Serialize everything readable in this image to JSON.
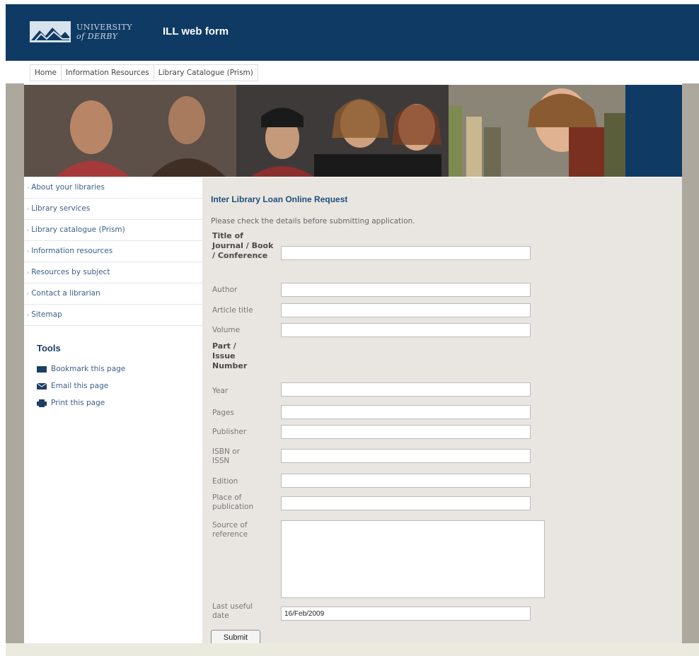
{
  "header": {
    "logo_line1": "UNIVERSITY",
    "logo_line2": "of DERBY",
    "app_title": "ILL web form"
  },
  "topnav": [
    "Home",
    "Information Resources",
    "Library Catalogue (Prism)"
  ],
  "sidebar": {
    "items": [
      "About your libraries",
      "Library services",
      "Library catalogue (Prism)",
      "Information resources",
      "Resources by subject",
      "Contact a librarian",
      "Sitemap"
    ],
    "tools_title": "Tools",
    "tools": [
      {
        "label": "Bookmark this page",
        "icon": "bookmark-icon"
      },
      {
        "label": "Email this page",
        "icon": "email-icon"
      },
      {
        "label": "Print this page",
        "icon": "print-icon"
      }
    ]
  },
  "form": {
    "title": "Inter Library Loan Online Request",
    "intro": "Please check the details before submitting application.",
    "fields": {
      "title_label": "Title of Journal / Book / Conference",
      "title_value": "",
      "author_label": "Author",
      "article_label": "Article title",
      "volume_label": "Volume",
      "part_label": "Part / Issue Number",
      "year_label": "Year",
      "pages_label": "Pages",
      "publisher_label": "Publisher",
      "isbn_label": "ISBN or ISSN",
      "edition_label": "Edition",
      "place_label": "Place of publication",
      "source_label": "Source of reference",
      "lastdate_label": "Last useful date",
      "lastdate_value": "16/Feb/2009"
    },
    "submit_label": "Submit"
  },
  "colors": {
    "header_bg": "#0f3a63",
    "main_bg": "#e9e6e1",
    "frame_bg": "#aca89d",
    "link": "#3a5f8a"
  }
}
